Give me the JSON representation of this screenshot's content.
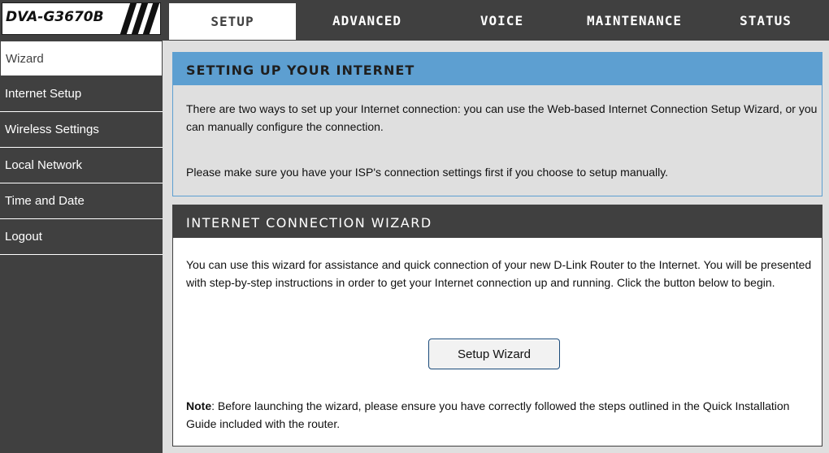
{
  "header": {
    "model": "DVA-G3670B",
    "tabs": [
      {
        "label": "SETUP",
        "active": true
      },
      {
        "label": "ADVANCED",
        "active": false
      },
      {
        "label": "VOICE",
        "active": false
      },
      {
        "label": "MAINTENANCE",
        "active": false
      },
      {
        "label": "STATUS",
        "active": false
      }
    ]
  },
  "sidebar": {
    "items": [
      {
        "label": "Wizard",
        "active": true
      },
      {
        "label": "Internet Setup",
        "active": false
      },
      {
        "label": "Wireless Settings",
        "active": false
      },
      {
        "label": "Local Network",
        "active": false
      },
      {
        "label": "Time and Date",
        "active": false
      },
      {
        "label": "Logout",
        "active": false
      }
    ]
  },
  "setup_section": {
    "title": "SETTING UP YOUR INTERNET",
    "para1": "There are two ways to set up your Internet connection: you can use the Web-based Internet Connection Setup Wizard, or you can manually configure the connection.",
    "para2": "Please make sure you have your ISP's connection settings first if you choose to setup manually."
  },
  "wizard_section": {
    "title": "INTERNET CONNECTION WIZARD",
    "para1": "You can use this wizard for assistance and quick connection of your new D-Link Router to the Internet. You will be presented with step-by-step instructions in order to get your Internet connection up and running. Click the button below to begin.",
    "button_label": "Setup Wizard",
    "note_label": "Note",
    "note_text": ": Before launching the wizard, please ensure you have correctly followed the steps outlined in the Quick Installation Guide included with the router."
  },
  "colors": {
    "dark": "#404040",
    "accent_blue": "#5d9fd1",
    "panel_gray": "#dfdfdf"
  }
}
